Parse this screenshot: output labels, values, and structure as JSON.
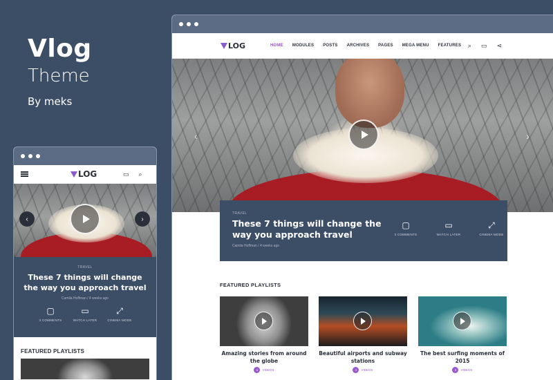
{
  "promo": {
    "title": "Vlog",
    "subtitle": "Theme",
    "author": "By meks"
  },
  "logo": "LOG",
  "nav": {
    "items": [
      "HOME",
      "MODULES",
      "POSTS",
      "ARCHIVES",
      "PAGES",
      "MEGA MENU",
      "FEATURES"
    ],
    "active": "HOME"
  },
  "icons": {
    "search": "⌕",
    "monitor": "▭",
    "share": "⋖"
  },
  "featured": {
    "category": "TRAVEL",
    "title": "These 7 things will change the way you approach travel",
    "author": "Camila Hoffman",
    "time": "4 weeks ago",
    "actions": [
      {
        "label": "3 COMMENTS",
        "icon": "▢"
      },
      {
        "label": "WATCH LATER",
        "icon": "▭"
      },
      {
        "label": "CINEMA MODE",
        "icon": "⤢"
      }
    ]
  },
  "playlists": {
    "heading": "FEATURED PLAYLISTS",
    "items": [
      {
        "title": "Amazing stories from around the globe",
        "count": "6",
        "tag": "VIDEOS"
      },
      {
        "title": "Beautiful airports and subway stations",
        "count": "4",
        "tag": "VIDEOS"
      },
      {
        "title": "The best surfing moments of 2015",
        "count": "5",
        "tag": "VIDEOS"
      }
    ]
  },
  "colors": {
    "accent": "#9b59d0",
    "dark": "#3c4d66"
  }
}
